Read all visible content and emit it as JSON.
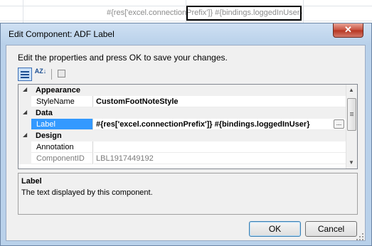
{
  "spreadsheet": {
    "cell_text": "#{res['excel.connectionPrefix']} #{bindings.loggedInUser}"
  },
  "dialog": {
    "title": "Edit Component: ADF Label",
    "close_glyph": "✕",
    "instructions": "Edit the properties and press OK to save your changes.",
    "toolbar": {
      "categorized_icon": "categorized-view-icon",
      "alphabetical_label": "AZ↓",
      "property_pages_icon": "property-pages-icon"
    },
    "grid": {
      "categories": [
        {
          "name": "Appearance",
          "properties": [
            {
              "name": "StyleName",
              "value": "CustomFootNoteStyle"
            }
          ]
        },
        {
          "name": "Data",
          "properties": [
            {
              "name": "Label",
              "value": "#{res['excel.connectionPrefix']} #{bindings.loggedInUser}",
              "ellipsis": "..."
            }
          ]
        },
        {
          "name": "Design",
          "properties": [
            {
              "name": "Annotation",
              "value": ""
            },
            {
              "name": "ComponentID",
              "value": "LBL1917449192"
            }
          ]
        }
      ],
      "selected_property": "Label",
      "expanded_glyph": "◢"
    },
    "description": {
      "title": "Label",
      "text": "The text displayed by this component."
    },
    "buttons": {
      "ok": "OK",
      "cancel": "Cancel"
    }
  }
}
